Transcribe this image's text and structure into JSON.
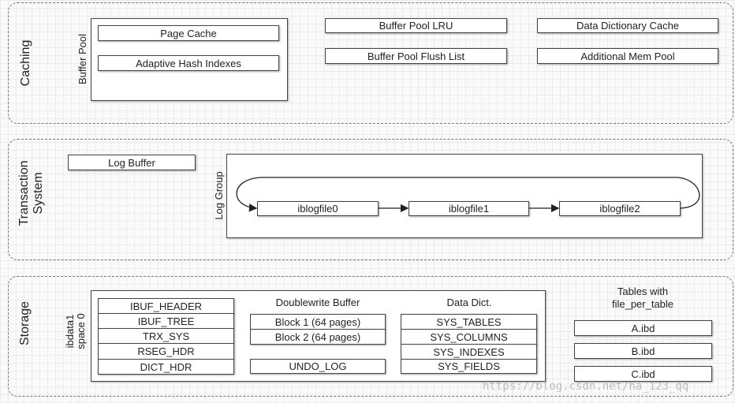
{
  "caching": {
    "label": "Caching",
    "buffer_pool": {
      "label": "Buffer Pool",
      "items": [
        "Page Cache",
        "Adaptive Hash Indexes"
      ]
    },
    "items": [
      "Buffer Pool LRU",
      "Buffer Pool Flush List",
      "Data Dictionary Cache",
      "Additional Mem Pool"
    ]
  },
  "transaction": {
    "label": "Transaction System",
    "log_buffer": "Log Buffer",
    "log_group": {
      "label": "Log Group",
      "files": [
        "iblogfile0",
        "iblogfile1",
        "iblogfile2"
      ]
    }
  },
  "storage": {
    "label": "Storage",
    "ibdata": {
      "label_line1": "ibdata1",
      "label_line2": "space 0",
      "headers": [
        "IBUF_HEADER",
        "IBUF_TREE",
        "TRX_SYS",
        "RSEG_HDR",
        "DICT_HDR"
      ],
      "doublewrite": {
        "label": "Doublewrite Buffer",
        "blocks": [
          "Block 1 (64 pages)",
          "Block 2 (64 pages)"
        ]
      },
      "undo_log": "UNDO_LOG",
      "data_dict": {
        "label": "Data Dict.",
        "tables": [
          "SYS_TABLES",
          "SYS_COLUMNS",
          "SYS_INDEXES",
          "SYS_FIELDS"
        ]
      }
    },
    "file_per_table": {
      "label_line1": "Tables with",
      "label_line2": "file_per_table",
      "files": [
        "A.ibd",
        "B.ibd",
        "C.ibd"
      ]
    }
  },
  "watermark": "https://blog.csdn.net/ha_123_qq"
}
